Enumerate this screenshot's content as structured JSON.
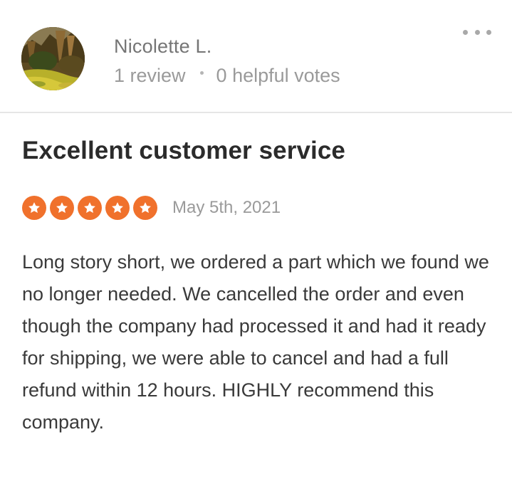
{
  "reviewer": {
    "name": "Nicolette L.",
    "review_count": "1 review",
    "helpful_votes": "0 helpful votes",
    "avatar_icon": "landscape-photo-avatar"
  },
  "menu": {
    "icon": "more-dots-icon"
  },
  "review": {
    "title": "Excellent customer service",
    "rating": 5,
    "rating_max": 5,
    "date": "May 5th, 2021",
    "body": "Long story short, we ordered a part which we found we no longer needed. We cancelled the order and even though the company had processed it and had it ready for shipping, we were able to cancel and had a full refund within 12 hours. HIGHLY recommend this company."
  },
  "colors": {
    "star": "#f0712c",
    "title": "#2b2b2b",
    "meta": "#9a9a9a",
    "body": "#3a3a3a",
    "divider": "#e6e6e6"
  }
}
